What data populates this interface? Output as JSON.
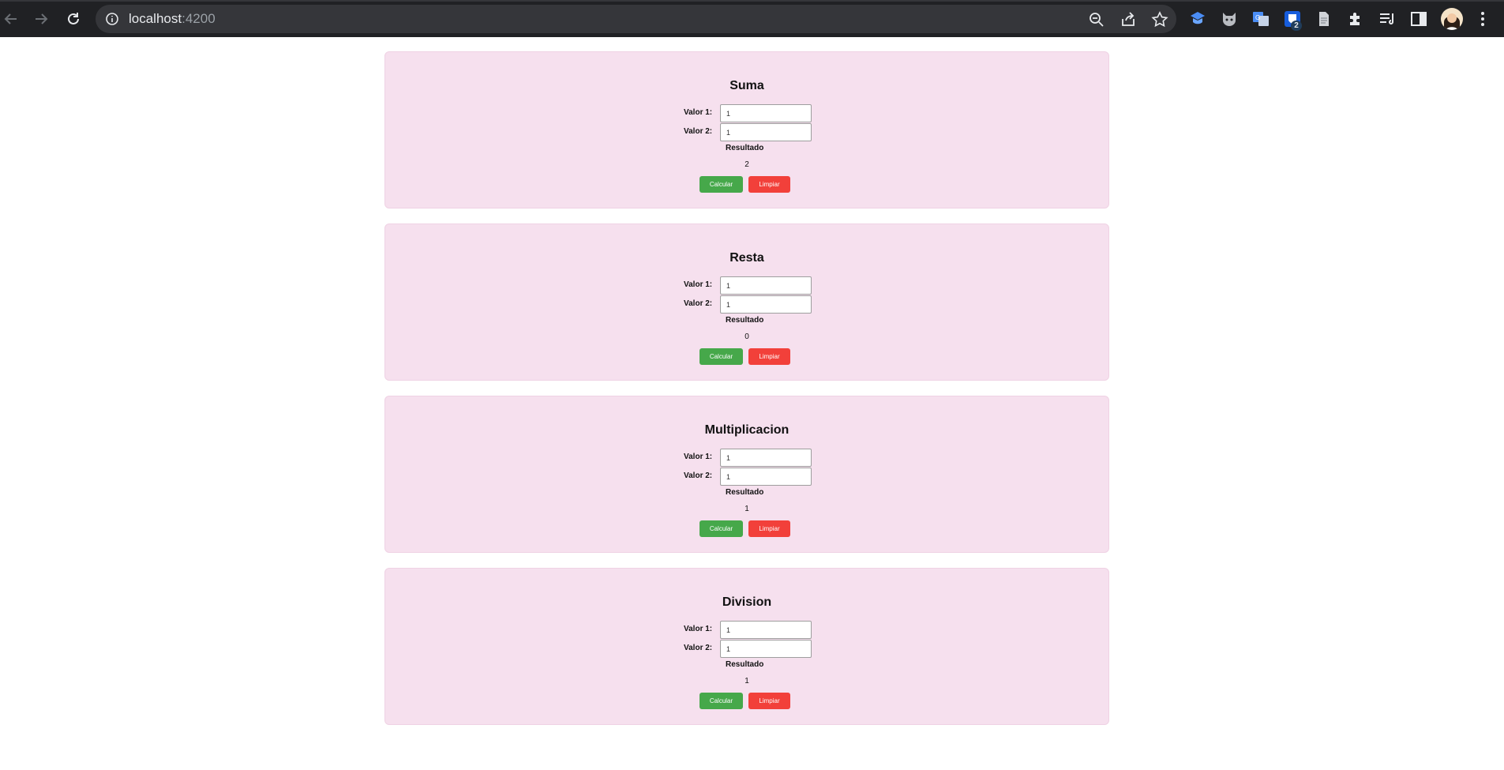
{
  "browser": {
    "url_host": "localhost",
    "url_port": ":4200",
    "extension_badge": "2"
  },
  "colors": {
    "card_bg": "#f6e0ee",
    "calc_button": "#46a84a",
    "clear_button": "#f2403a"
  },
  "icons": [
    "back-icon",
    "forward-icon",
    "reload-icon",
    "site-info-icon",
    "zoom-out-icon",
    "share-icon",
    "bookmark-star-icon",
    "extension-icon",
    "cat-extension-icon",
    "translate-icon",
    "bitwarden-icon",
    "document-icon",
    "puzzle-extensions-icon",
    "reading-list-icon",
    "side-panel-icon",
    "profile-avatar",
    "menu-kebab-icon"
  ],
  "cards": [
    {
      "title": "Suma",
      "label1": "Valor 1:",
      "value1": "1",
      "label2": "Valor 2:",
      "value2": "1",
      "result_label": "Resultado",
      "result": "2",
      "calc_label": "Calcular",
      "clear_label": "Limpiar"
    },
    {
      "title": "Resta",
      "label1": "Valor 1:",
      "value1": "1",
      "label2": "Valor 2:",
      "value2": "1",
      "result_label": "Resultado",
      "result": "0",
      "calc_label": "Calcular",
      "clear_label": "Limpiar"
    },
    {
      "title": "Multiplicacion",
      "label1": "Valor 1:",
      "value1": "1",
      "label2": "Valor 2:",
      "value2": "1",
      "result_label": "Resultado",
      "result": "1",
      "calc_label": "Calcular",
      "clear_label": "Limpiar"
    },
    {
      "title": "Division",
      "label1": "Valor 1:",
      "value1": "1",
      "label2": "Valor 2:",
      "value2": "1",
      "result_label": "Resultado",
      "result": "1",
      "calc_label": "Calcular",
      "clear_label": "Limpiar"
    }
  ]
}
